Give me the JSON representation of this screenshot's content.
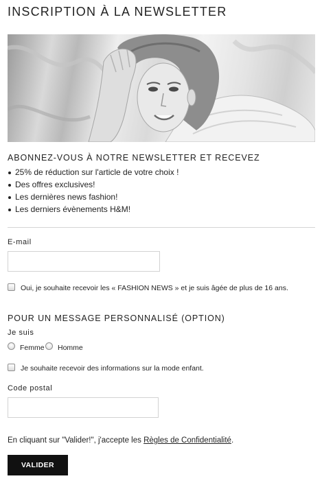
{
  "page_title": "INSCRIPTION À LA NEWSLETTER",
  "benefits": {
    "heading": "ABONNEZ-VOUS À NOTRE NEWSLETTER ET RECEVEZ",
    "items": [
      "25% de réduction sur l'article de votre choix !",
      "Des offres exclusives!",
      "Les dernières news fashion!",
      "Les derniers évènements H&M!"
    ]
  },
  "form": {
    "email": {
      "label": "E-mail",
      "value": "",
      "placeholder": ""
    },
    "fashion_news_consent": {
      "label": "Oui, je souhaite recevoir les « FASHION NEWS » et je suis âgée de plus de 16 ans.",
      "checked": false
    },
    "personalized": {
      "heading": "POUR UN MESSAGE PERSONNALISÉ (OPTION)",
      "gender_label": "Je suis",
      "gender_options": [
        "Femme",
        "Homme"
      ],
      "kids_consent": {
        "label": "Je souhaite recevoir des informations sur la mode enfant.",
        "checked": false
      }
    },
    "postal_code": {
      "label": "Code postal",
      "value": "",
      "placeholder": ""
    },
    "privacy": {
      "prefix": "En cliquant sur \"Valider!\", j'accepte les ",
      "link_text": "Règles de Confidentialité",
      "suffix": "."
    },
    "submit_label": "VALIDER"
  },
  "colors": {
    "button_background": "#111111",
    "button_text": "#ffffff",
    "divider": "#d4d4d4",
    "input_border": "#d2d2d2"
  }
}
